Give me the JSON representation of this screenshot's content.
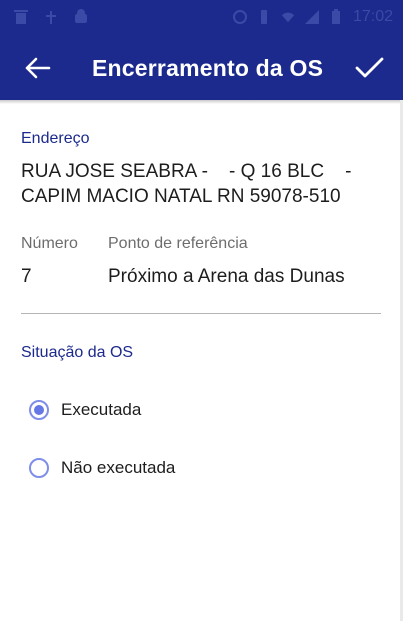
{
  "status_bar": {
    "time": "17:02"
  },
  "app_bar": {
    "title": "Encerramento da OS"
  },
  "address": {
    "label": "Endereço",
    "line1": "RUA JOSE SEABRA -    - Q 16 BLC    -",
    "line2": "CAPIM MACIO NATAL RN 59078-510"
  },
  "number": {
    "label": "Número",
    "value": "7"
  },
  "reference": {
    "label": "Ponto de referência",
    "value": "Próximo a Arena das Dunas"
  },
  "situation": {
    "label": "Situação da OS",
    "options": [
      {
        "label": "Executada",
        "selected": true
      },
      {
        "label": "Não executada",
        "selected": false
      }
    ]
  },
  "colors": {
    "primary": "#1b2a8c",
    "radio_accent": "#6578e6"
  }
}
